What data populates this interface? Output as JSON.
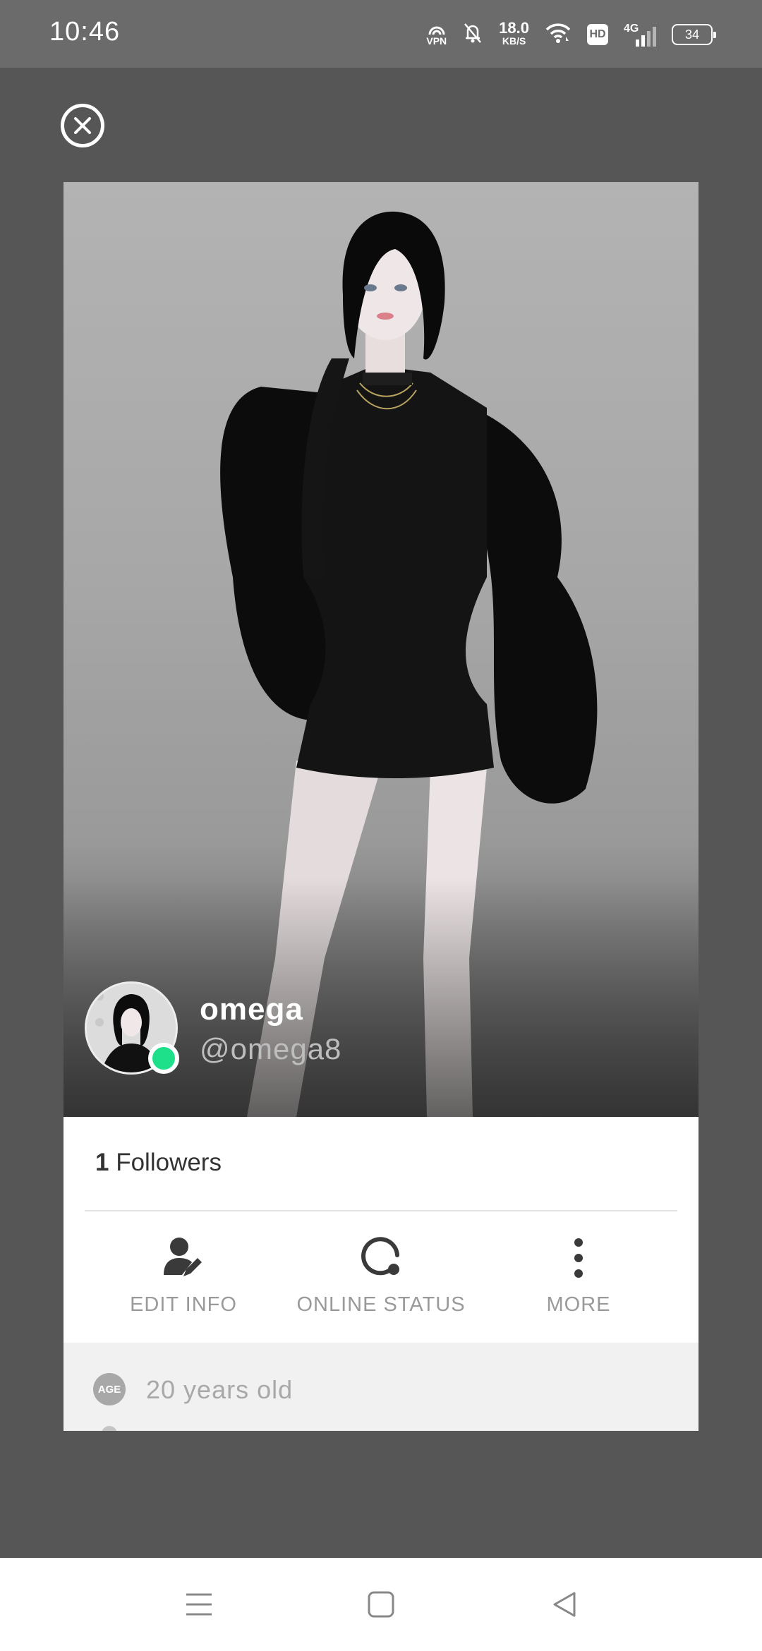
{
  "status_bar": {
    "time": "10:46",
    "vpn_label": "VPN",
    "speed_value": "18.0",
    "speed_unit": "KB/S",
    "hd_label": "HD",
    "network_label": "4G",
    "battery_level": "34"
  },
  "profile": {
    "display_name": "omega",
    "handle": "@omega8",
    "online": true,
    "online_color": "#1ee08a"
  },
  "stats": {
    "followers_count": "1",
    "followers_label": "Followers"
  },
  "actions": [
    {
      "label": "EDIT INFO",
      "icon": "edit-person-icon"
    },
    {
      "label": "ONLINE STATUS",
      "icon": "online-status-icon"
    },
    {
      "label": "MORE",
      "icon": "more-vertical-icon"
    }
  ],
  "details": {
    "age_badge": "AGE",
    "age_text": "20 years old"
  },
  "nav": {
    "icons": [
      "menu-icon",
      "home-square-icon",
      "back-triangle-icon"
    ]
  }
}
